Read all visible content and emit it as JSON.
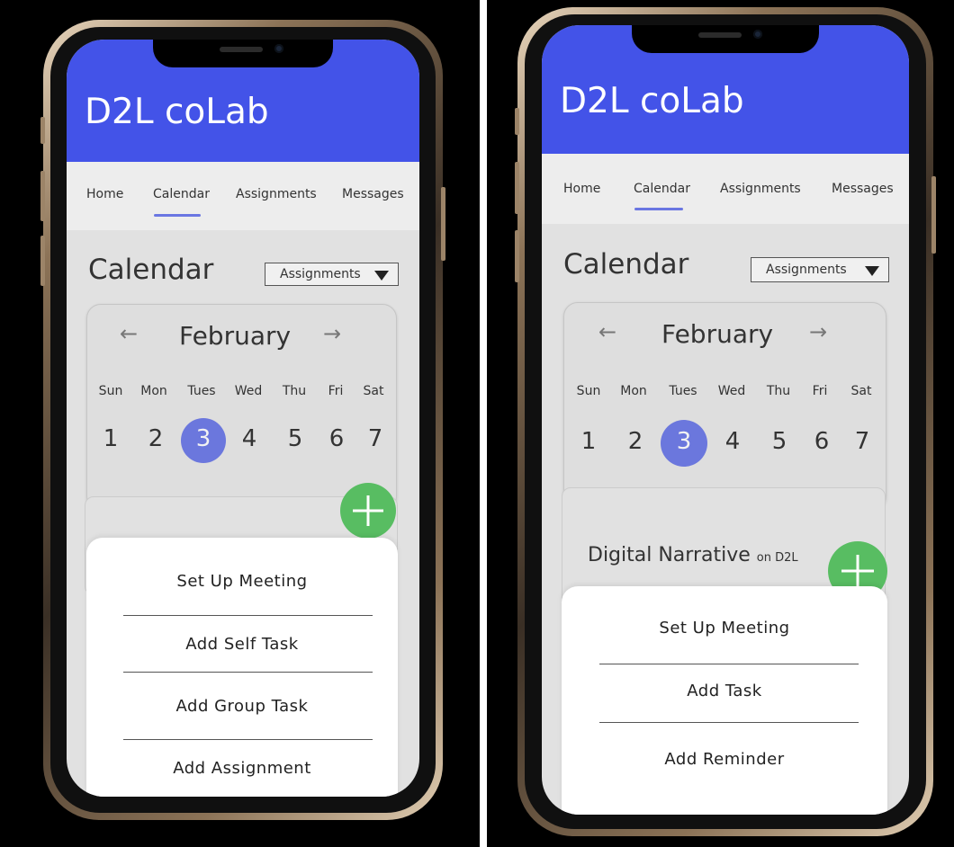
{
  "screens": [
    {
      "app_title": "D2L coLab",
      "nav": [
        "Home",
        "Calendar",
        "Assignments",
        "Messages"
      ],
      "active_tab": "Calendar",
      "page_title": "Calendar",
      "filter_value": "Assignments",
      "month": "February",
      "prev_icon": "arrow-left-icon",
      "next_icon": "arrow-right-icon",
      "weekdays": [
        "Sun",
        "Mon",
        "Tues",
        "Wed",
        "Thu",
        "Fri",
        "Sat"
      ],
      "days": [
        "1",
        "2",
        "3",
        "4",
        "5",
        "6",
        "7"
      ],
      "selected_day": "3",
      "fab_icon": "plus-icon",
      "event": null,
      "sheet_options": [
        "Set Up Meeting",
        "Add Self Task",
        "Add Group Task",
        "Add Assignment"
      ]
    },
    {
      "app_title": "D2L coLab",
      "nav": [
        "Home",
        "Calendar",
        "Assignments",
        "Messages"
      ],
      "active_tab": "Calendar",
      "page_title": "Calendar",
      "filter_value": "Assignments",
      "month": "February",
      "prev_icon": "arrow-left-icon",
      "next_icon": "arrow-right-icon",
      "weekdays": [
        "Sun",
        "Mon",
        "Tues",
        "Wed",
        "Thu",
        "Fri",
        "Sat"
      ],
      "days": [
        "1",
        "2",
        "3",
        "4",
        "5",
        "6",
        "7"
      ],
      "selected_day": "3",
      "fab_icon": "plus-icon",
      "event": {
        "title": "Digital Narrative",
        "subtitle": "on D2L"
      },
      "sheet_options": [
        "Set Up Meeting",
        "Add Task",
        "Add Reminder"
      ]
    }
  ],
  "colors": {
    "header": "#4353e8",
    "selected_day": "#6b77dd",
    "fab": "#58bd62",
    "tab_underline": "#6a76e2"
  }
}
